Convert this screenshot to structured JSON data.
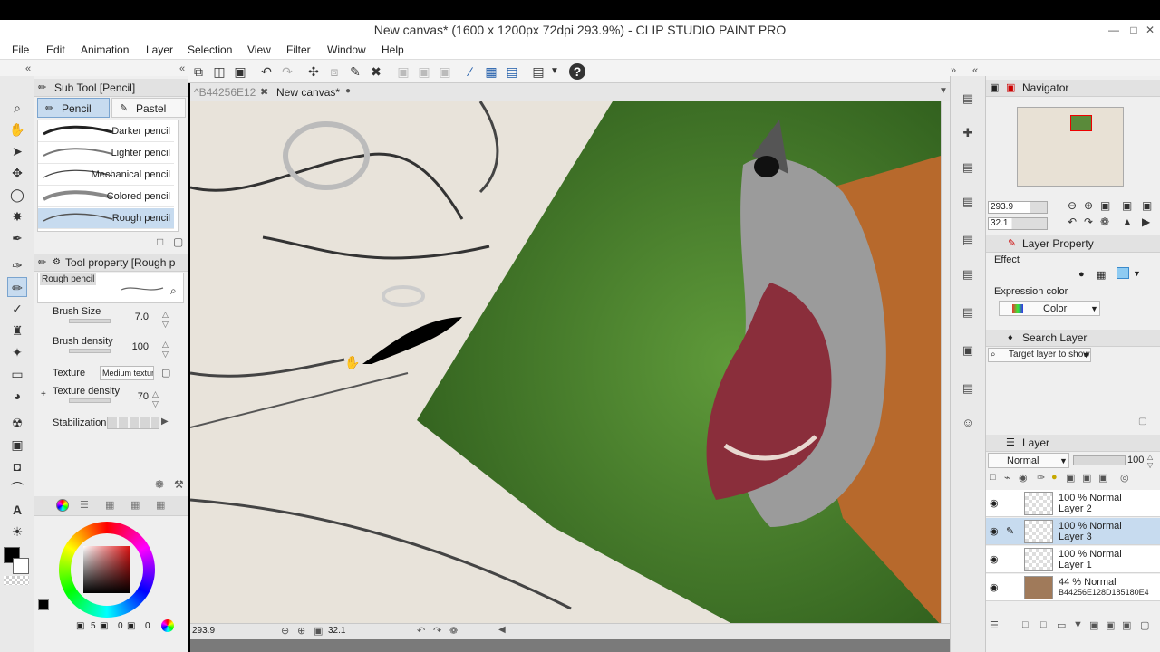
{
  "window": {
    "title": "New canvas* (1600 x 1200px 72dpi 293.9%)  - CLIP STUDIO PAINT PRO"
  },
  "menu": [
    "File",
    "Edit",
    "Animation",
    "Layer",
    "Selection",
    "View",
    "Filter",
    "Window",
    "Help"
  ],
  "tabs": [
    {
      "label": "^B44256E12"
    },
    {
      "label": "New canvas*"
    }
  ],
  "subtool": {
    "header": "Sub Tool [Pencil]",
    "tabs": [
      "Pencil",
      "Pastel"
    ],
    "brushes": [
      "Darker pencil",
      "Lighter pencil",
      "Mechanical pencil",
      "Colored pencil",
      "Rough pencil"
    ]
  },
  "toolprop": {
    "header": "Tool property [Rough p",
    "preview_name": "Rough pencil",
    "brush_size_label": "Brush Size",
    "brush_size": "7.0",
    "brush_density_label": "Brush density",
    "brush_density": "100",
    "texture_label": "Texture",
    "texture_value": "Medium texture",
    "texture_density_label": "Texture density",
    "texture_density": "70",
    "stabilization_label": "Stabilization"
  },
  "color": {
    "fg": "#000000",
    "bg": "#ffffff",
    "readout": [
      "5",
      "0",
      "0"
    ]
  },
  "navigator": {
    "header": "Navigator",
    "zoom": "293.9",
    "angle": "32.1"
  },
  "layer_property": {
    "header": "Layer Property",
    "effect_label": "Effect",
    "expression_label": "Expression color",
    "expression_value": "Color"
  },
  "search_layer": {
    "header": "Search Layer",
    "target": "Target layer to show"
  },
  "layers_panel": {
    "header": "Layer",
    "blend": "Normal",
    "opacity": "100",
    "layers": [
      {
        "line1": "100 %  Normal",
        "line2": "Layer 2"
      },
      {
        "line1": "100 %  Normal",
        "line2": "Layer 3"
      },
      {
        "line1": "100 %  Normal",
        "line2": "Layer 1"
      },
      {
        "line1": "44 %  Normal",
        "line2": "B44256E128D185180E4"
      }
    ]
  },
  "status": {
    "zoom": "293.9",
    "angle": "32.1"
  }
}
